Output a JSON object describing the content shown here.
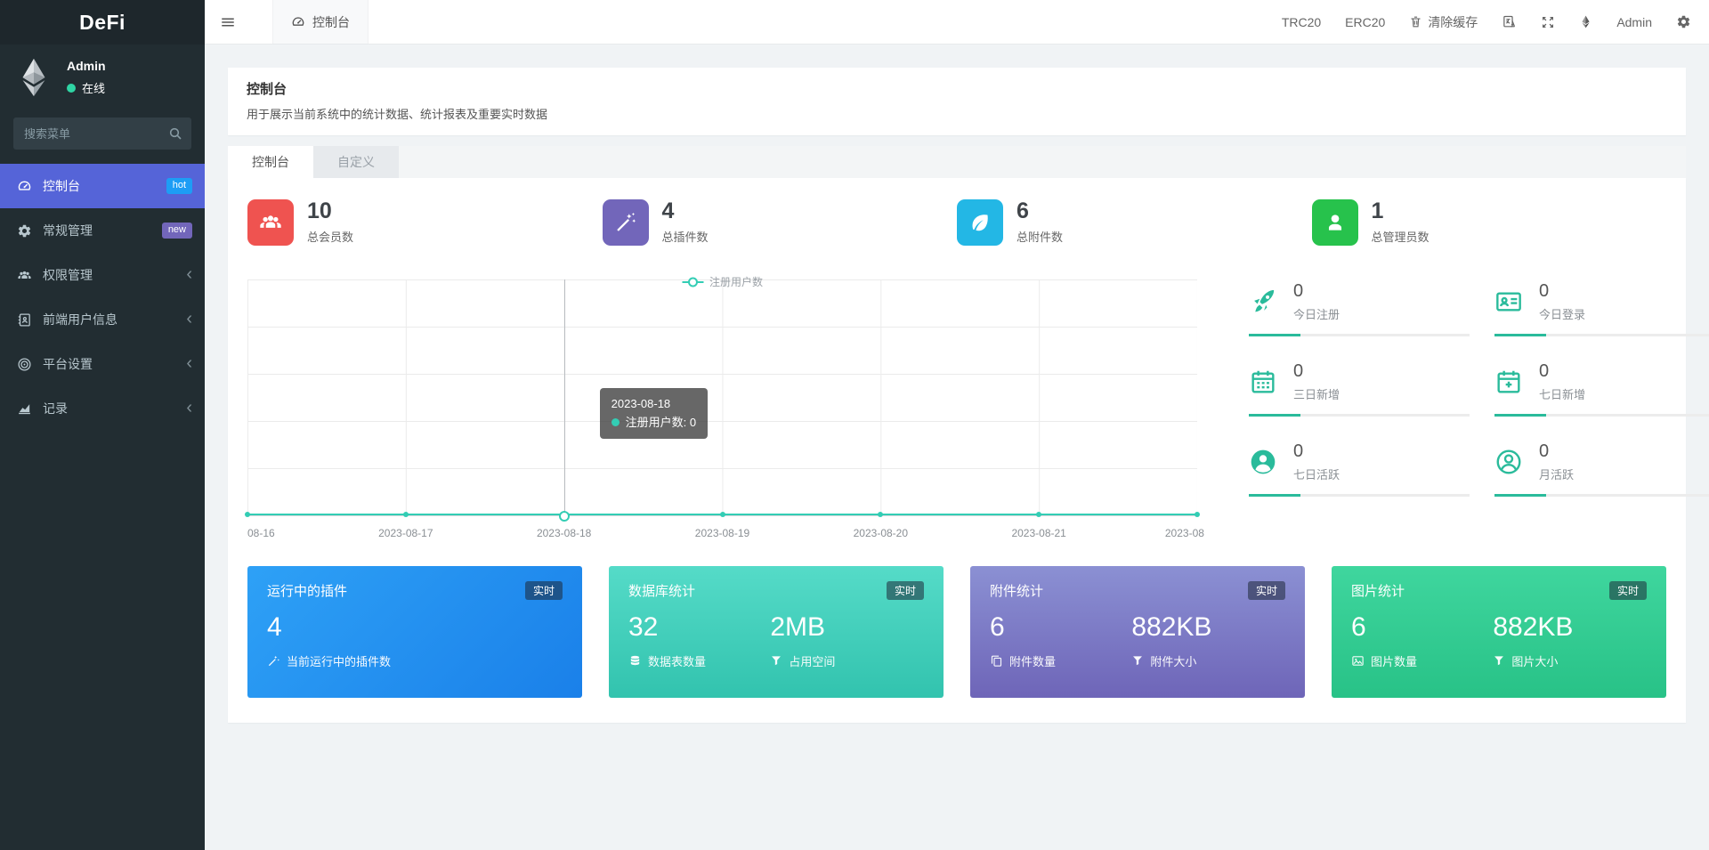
{
  "app": {
    "brand": "DeFi"
  },
  "colors": {
    "sidebar_bg": "#222d32",
    "active_menu": "#5564d8",
    "hot_badge": "#1d9df5",
    "new_badge": "#7266ba",
    "stat_red": "#ef5350",
    "stat_purple": "#7266ba",
    "stat_cyan": "#23b7e5",
    "stat_green": "#27c24c",
    "mini_teal": "#2abb9b",
    "series_teal": "#33cdb4",
    "card_blue": "#1d8cf0",
    "card_teal": "#3ecdb8",
    "card_purple": "#7a74c4",
    "card_green": "#32cc92"
  },
  "sidebar": {
    "user": {
      "name": "Admin",
      "status": "在线"
    },
    "search_placeholder": "搜索菜单",
    "items": [
      {
        "label": "控制台",
        "icon": "dashboard-icon",
        "badge": "hot"
      },
      {
        "label": "常规管理",
        "icon": "gears-icon",
        "badge": "new"
      },
      {
        "label": "权限管理",
        "icon": "users-icon",
        "chevron": "‹"
      },
      {
        "label": "前端用户信息",
        "icon": "address-book-icon",
        "chevron": "‹"
      },
      {
        "label": "平台设置",
        "icon": "bullseye-icon",
        "chevron": "‹"
      },
      {
        "label": "记录",
        "icon": "area-chart-icon",
        "chevron": "‹"
      }
    ]
  },
  "topbar": {
    "tab_label": "控制台",
    "links": [
      "TRC20",
      "ERC20"
    ],
    "clear_cache_label": "清除缓存",
    "username": "Admin"
  },
  "page": {
    "title": "控制台",
    "subtitle": "用于展示当前系统中的统计数据、统计报表及重要实时数据",
    "tabs": [
      {
        "label": "控制台",
        "active": true
      },
      {
        "label": "自定义",
        "active": false
      }
    ]
  },
  "stats": [
    {
      "value": "10",
      "label": "总会员数",
      "icon": "members-icon",
      "color": "#ef5350"
    },
    {
      "value": "4",
      "label": "总插件数",
      "icon": "magic-wand-icon",
      "color": "#7266ba"
    },
    {
      "value": "6",
      "label": "总附件数",
      "icon": "leaf-icon",
      "color": "#23b7e5"
    },
    {
      "value": "1",
      "label": "总管理员数",
      "icon": "admin-user-icon",
      "color": "#27c24c"
    }
  ],
  "chart_data": {
    "type": "line",
    "x": [
      "08-16",
      "2023-08-17",
      "2023-08-18",
      "2023-08-19",
      "2023-08-20",
      "2023-08-21",
      "2023-08"
    ],
    "series": [
      {
        "name": "注册用户数",
        "values": [
          0,
          0,
          0,
          0,
          0,
          0,
          0
        ],
        "color": "#33cdb4"
      }
    ],
    "ylim": [
      0,
      1
    ],
    "grid": true,
    "legend_position": "top-center",
    "hover": {
      "index": 2,
      "title": "2023-08-18",
      "label": "注册用户数: 0"
    }
  },
  "mini_stats": [
    {
      "value": "0",
      "label": "今日注册",
      "icon": "rocket-icon"
    },
    {
      "value": "0",
      "label": "今日登录",
      "icon": "id-card-icon"
    },
    {
      "value": "0",
      "label": "三日新增",
      "icon": "calendar-icon"
    },
    {
      "value": "0",
      "label": "七日新增",
      "icon": "calendar-plus-icon"
    },
    {
      "value": "0",
      "label": "七日活跃",
      "icon": "user-circle-solid-icon"
    },
    {
      "value": "0",
      "label": "月活跃",
      "icon": "user-circle-outline-icon"
    }
  ],
  "panels": [
    {
      "title": "运行中的插件",
      "badge": "实时",
      "primary": {
        "value": "4",
        "label": "当前运行中的插件数",
        "icon": "magic-wand-icon"
      }
    },
    {
      "title": "数据库统计",
      "badge": "实时",
      "primary": {
        "value": "32",
        "label": "数据表数量",
        "icon": "database-icon"
      },
      "secondary": {
        "value": "2MB",
        "label": "占用空间",
        "icon": "filter-icon"
      }
    },
    {
      "title": "附件统计",
      "badge": "实时",
      "primary": {
        "value": "6",
        "label": "附件数量",
        "icon": "copy-icon"
      },
      "secondary": {
        "value": "882KB",
        "label": "附件大小",
        "icon": "filter-icon"
      }
    },
    {
      "title": "图片统计",
      "badge": "实时",
      "primary": {
        "value": "6",
        "label": "图片数量",
        "icon": "image-icon"
      },
      "secondary": {
        "value": "882KB",
        "label": "图片大小",
        "icon": "filter-icon"
      }
    }
  ]
}
